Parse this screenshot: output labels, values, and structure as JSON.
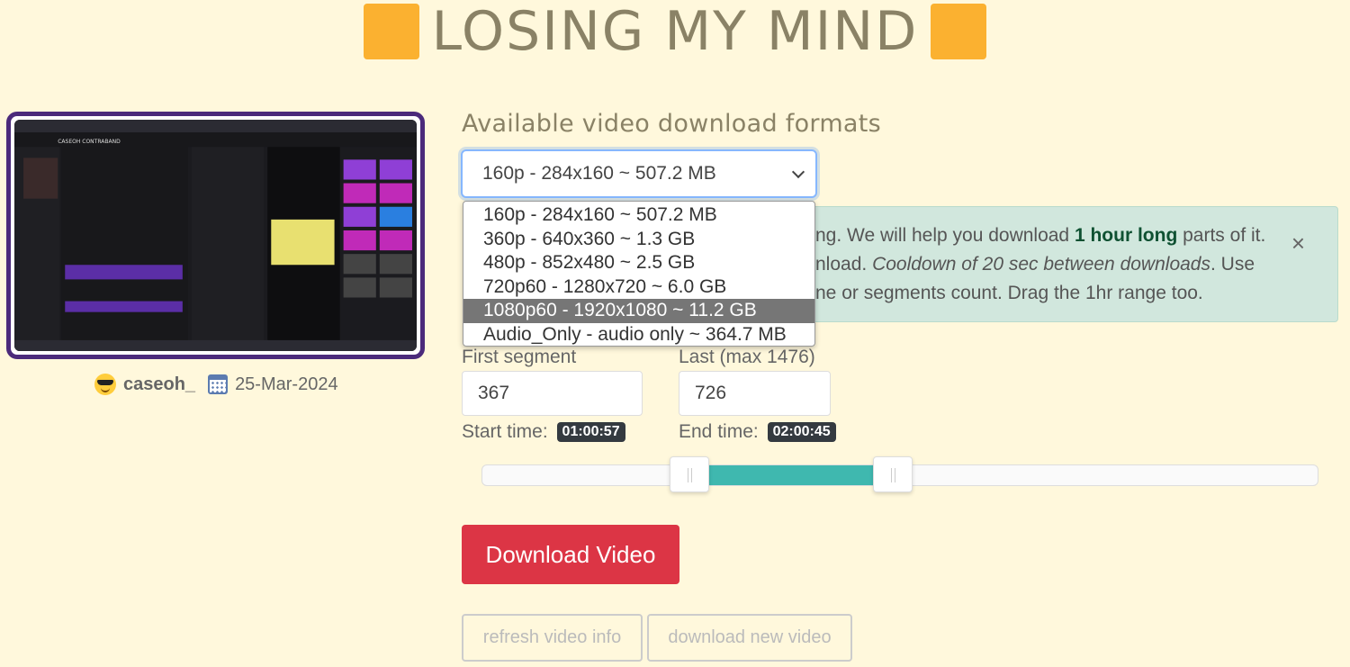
{
  "header": {
    "title": "LOSING MY MIND",
    "icon": "orange-square"
  },
  "video": {
    "username": "caseoh_",
    "date": "25-Mar-2024",
    "thumbnail_title": "CASEOH CONTRABAND"
  },
  "formats": {
    "title": "Available video download formats",
    "selected": "160p - 284x160 ~ 507.2 MB",
    "options": [
      "160p - 284x160 ~ 507.2 MB",
      "360p - 640x360 ~ 1.3 GB",
      "480p - 852x480 ~ 2.5 GB",
      "720p60 - 1280x720 ~ 6.0 GB",
      "1080p60 - 1920x1080 ~ 11.2 GB",
      "Audio_Only - audio only ~ 364.7 MB"
    ],
    "highlighted_index": 4
  },
  "alert": {
    "line1_pre": "ng. We will help you download ",
    "line1_bold": "1 hour long",
    "line1_post": " parts of it.",
    "line2_pre": "nload. ",
    "line2_italic": "Cooldown of 20 sec between downloads",
    "line2_post": ". Use",
    "line3": "ne or segments count. Drag the 1hr range too.",
    "close": "×"
  },
  "segments": {
    "first_label": "First segment",
    "first_value": "367",
    "last_label": "Last (max 1476)",
    "last_value": "726",
    "start_label": "Start time:",
    "start_time": "01:00:57",
    "end_label": "End time:",
    "end_time": "02:00:45"
  },
  "slider": {
    "start_fraction": 0.248,
    "end_fraction": 0.491
  },
  "buttons": {
    "download": "Download Video",
    "refresh": "refresh video info",
    "new_video": "download new video"
  },
  "colors": {
    "background": "#fff8dc",
    "accent_orange": "#fbb130",
    "download_red": "#dc3545",
    "slider_teal": "#3fb8af",
    "alert_green": "#d1e7dd",
    "thumbnail_border": "#4b2a7b"
  }
}
